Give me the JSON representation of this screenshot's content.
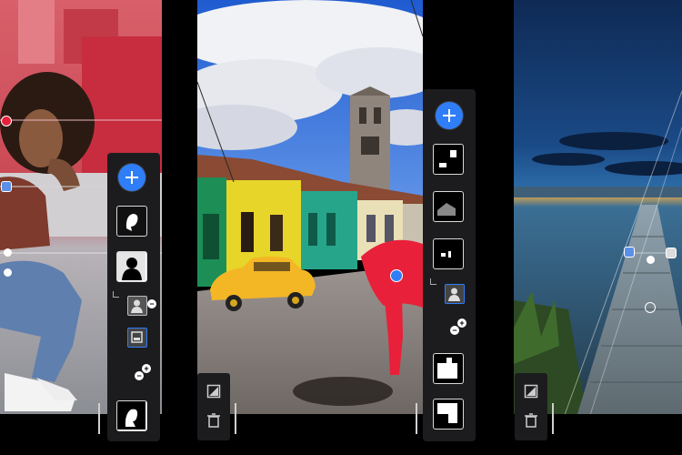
{
  "screens": [
    {
      "name": "portrait-mask-screen",
      "subject": "woman-portrait"
    },
    {
      "name": "street-subject-screen",
      "subject": "red-umbrella-street"
    },
    {
      "name": "pier-gradient-screen",
      "subject": "pier-seascape"
    }
  ],
  "icons": {
    "add": "plus-icon",
    "delete": "trash-icon",
    "mask": "mask-icon",
    "person": "person-icon",
    "add_subtract": "plus-minus-icon"
  },
  "colors": {
    "accent": "#2f7ef7",
    "mask_overlay": "#e8203a",
    "panel": "#1c1c1e"
  }
}
